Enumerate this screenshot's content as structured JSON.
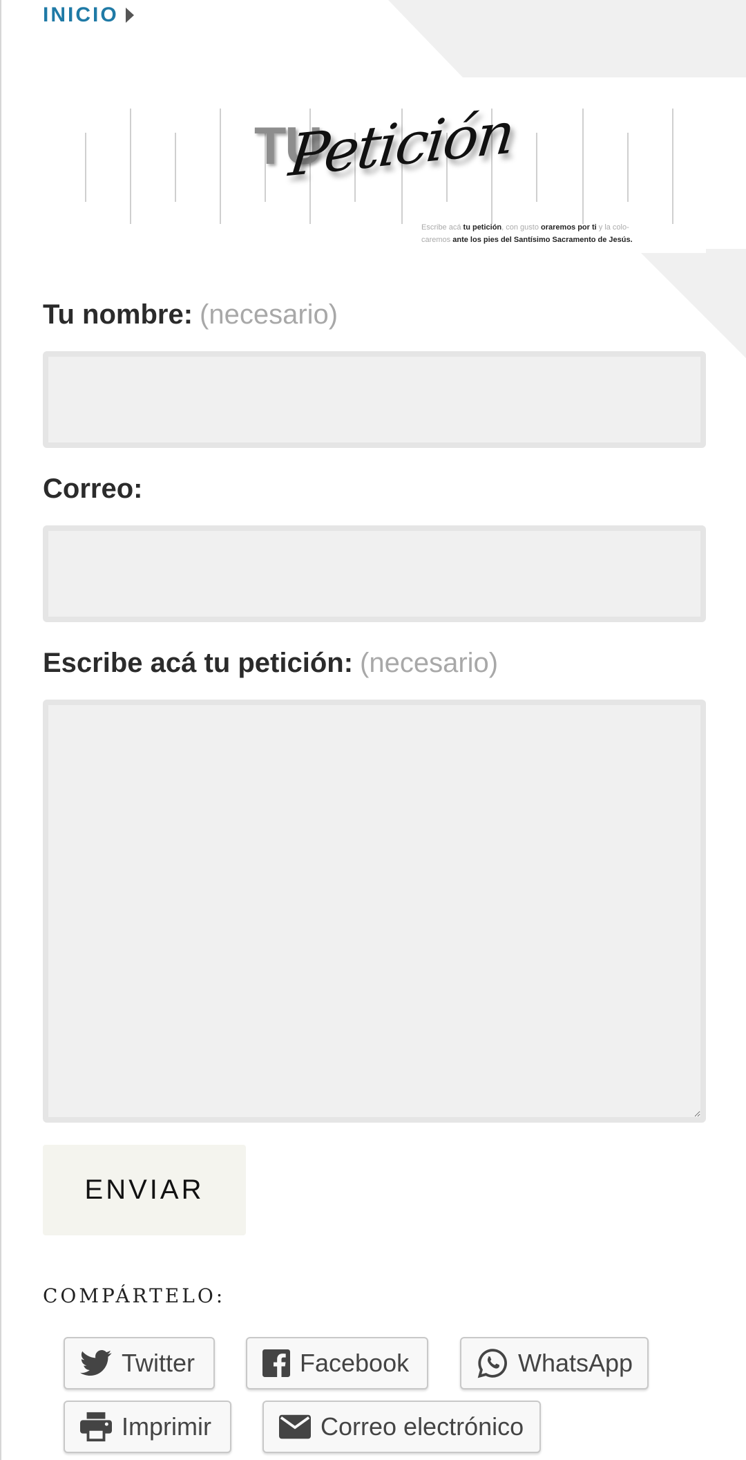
{
  "breadcrumb": {
    "home_label": "INICIO"
  },
  "banner": {
    "tu_text": "TU",
    "script_text": "Petición",
    "caption_part1": "Escribe acá ",
    "caption_bold1": "tu petición",
    "caption_part2": ", con gusto ",
    "caption_bold2": "oraremos por ti",
    "caption_part3": " y la colo-caremos ",
    "caption_bold3": "ante los pies del Santísimo Sacramento de Jesús."
  },
  "form": {
    "name_label": "Tu nombre:",
    "name_required": "(necesario)",
    "name_value": "",
    "email_label": "Correo:",
    "email_value": "",
    "petition_label": "Escribe acá tu petición:",
    "petition_required": "(necesario)",
    "petition_value": "",
    "submit_label": "ENVIAR"
  },
  "share": {
    "title": "COMPÁRTELO:",
    "buttons": [
      {
        "label": "Twitter",
        "icon": "twitter-icon"
      },
      {
        "label": "Facebook",
        "icon": "facebook-icon"
      },
      {
        "label": "WhatsApp",
        "icon": "whatsapp-icon"
      },
      {
        "label": "Imprimir",
        "icon": "printer-icon"
      },
      {
        "label": "Correo electrónico",
        "icon": "email-icon"
      }
    ]
  },
  "colors": {
    "link_blue": "#1f7aa6",
    "input_bg": "#f0f0f0",
    "submit_bg": "#f4f4ee"
  }
}
